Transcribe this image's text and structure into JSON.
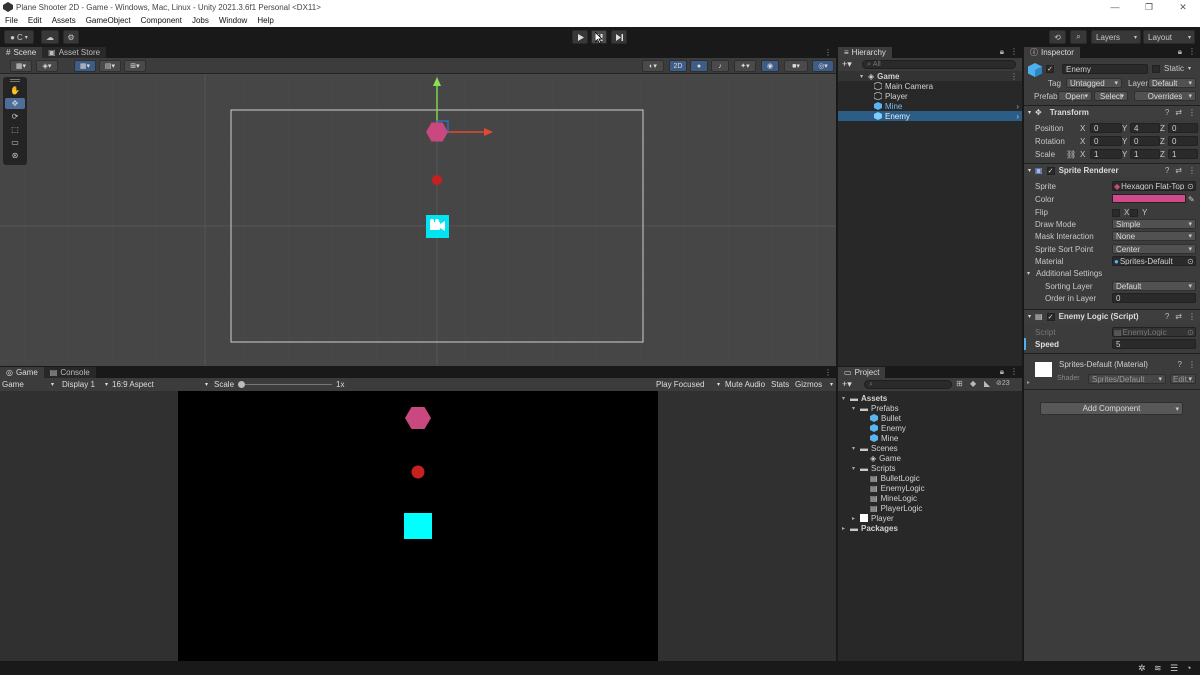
{
  "window": {
    "title": "Plane Shooter 2D - Game - Windows, Mac, Linux - Unity 2021.3.6f1 Personal <DX11>"
  },
  "menu": [
    "File",
    "Edit",
    "Assets",
    "GameObject",
    "Component",
    "Jobs",
    "Window",
    "Help"
  ],
  "toolbar": {
    "account_label": "C",
    "layers_label": "Layers",
    "layout_label": "Layout",
    "play_icon": "play-icon",
    "pause_icon": "pause-icon",
    "step_icon": "step-icon"
  },
  "scene_panel": {
    "tabs": [
      "Scene",
      "Asset Store"
    ],
    "mode_2d_label": "2D"
  },
  "game_panel": {
    "tabs": [
      "Game",
      "Console"
    ],
    "game_dropdown": "Game",
    "display_dropdown": "Display 1",
    "aspect_dropdown": "16:9 Aspect",
    "scale_label": "Scale",
    "scale_value": "1x",
    "play_focused": "Play Focused",
    "mute_audio": "Mute Audio",
    "stats": "Stats",
    "gizmos": "Gizmos"
  },
  "hierarchy": {
    "tab": "Hierarchy",
    "search_placeholder": "All",
    "items": [
      {
        "label": "Game",
        "depth": 0,
        "type": "scene"
      },
      {
        "label": "Main Camera",
        "depth": 1,
        "type": "object"
      },
      {
        "label": "Player",
        "depth": 1,
        "type": "object"
      },
      {
        "label": "Mine",
        "depth": 1,
        "type": "prefab"
      },
      {
        "label": "Enemy",
        "depth": 1,
        "type": "prefab",
        "selected": true
      }
    ]
  },
  "project": {
    "tab": "Project",
    "badge_count": "23",
    "items": [
      {
        "label": "Assets",
        "depth": 0,
        "type": "folder"
      },
      {
        "label": "Prefabs",
        "depth": 1,
        "type": "folder"
      },
      {
        "label": "Bullet",
        "depth": 2,
        "type": "prefab"
      },
      {
        "label": "Enemy",
        "depth": 2,
        "type": "prefab"
      },
      {
        "label": "Mine",
        "depth": 2,
        "type": "prefab"
      },
      {
        "label": "Scenes",
        "depth": 1,
        "type": "folder"
      },
      {
        "label": "Game",
        "depth": 2,
        "type": "scene"
      },
      {
        "label": "Scripts",
        "depth": 1,
        "type": "folder"
      },
      {
        "label": "BulletLogic",
        "depth": 2,
        "type": "script"
      },
      {
        "label": "EnemyLogic",
        "depth": 2,
        "type": "script"
      },
      {
        "label": "MineLogic",
        "depth": 2,
        "type": "script"
      },
      {
        "label": "PlayerLogic",
        "depth": 2,
        "type": "script"
      },
      {
        "label": "Player",
        "depth": 1,
        "type": "sprite"
      },
      {
        "label": "Packages",
        "depth": 0,
        "type": "folder"
      }
    ]
  },
  "inspector": {
    "tab": "Inspector",
    "object_name": "Enemy",
    "static_label": "Static",
    "tag_label": "Tag",
    "tag_value": "Untagged",
    "layer_label": "Layer",
    "layer_value": "Default",
    "prefab_label": "Prefab",
    "prefab_open": "Open",
    "prefab_select": "Select",
    "prefab_overrides": "Overrides",
    "transform": {
      "title": "Transform",
      "position": {
        "label": "Position",
        "x": "0",
        "y": "4",
        "z": "0"
      },
      "rotation": {
        "label": "Rotation",
        "x": "0",
        "y": "0",
        "z": "0"
      },
      "scale": {
        "label": "Scale",
        "x": "1",
        "y": "1",
        "z": "1"
      }
    },
    "sprite_renderer": {
      "title": "Sprite Renderer",
      "sprite_label": "Sprite",
      "sprite_value": "Hexagon Flat-Top",
      "color_label": "Color",
      "color_value": "#d14a8c",
      "flip_label": "Flip",
      "flip_x": "X",
      "flip_y": "Y",
      "draw_mode_label": "Draw Mode",
      "draw_mode_value": "Simple",
      "mask_label": "Mask Interaction",
      "mask_value": "None",
      "sort_point_label": "Sprite Sort Point",
      "sort_point_value": "Center",
      "material_label": "Material",
      "material_value": "Sprites-Default",
      "additional_label": "Additional Settings",
      "sorting_layer_label": "Sorting Layer",
      "sorting_layer_value": "Default",
      "order_label": "Order in Layer",
      "order_value": "0"
    },
    "enemy_logic": {
      "title": "Enemy Logic (Script)",
      "script_label": "Script",
      "script_value": "EnemyLogic",
      "speed_label": "Speed",
      "speed_value": "5"
    },
    "material": {
      "title": "Sprites-Default (Material)",
      "shader_label": "Shader",
      "shader_value": "Sprites/Default",
      "edit_label": "Edit..."
    },
    "add_component": "Add Component"
  },
  "colors": {
    "enemy": "#c9487f",
    "mine": "#c81f1f",
    "player": "#00ffff",
    "selection": "#2c5d87"
  }
}
